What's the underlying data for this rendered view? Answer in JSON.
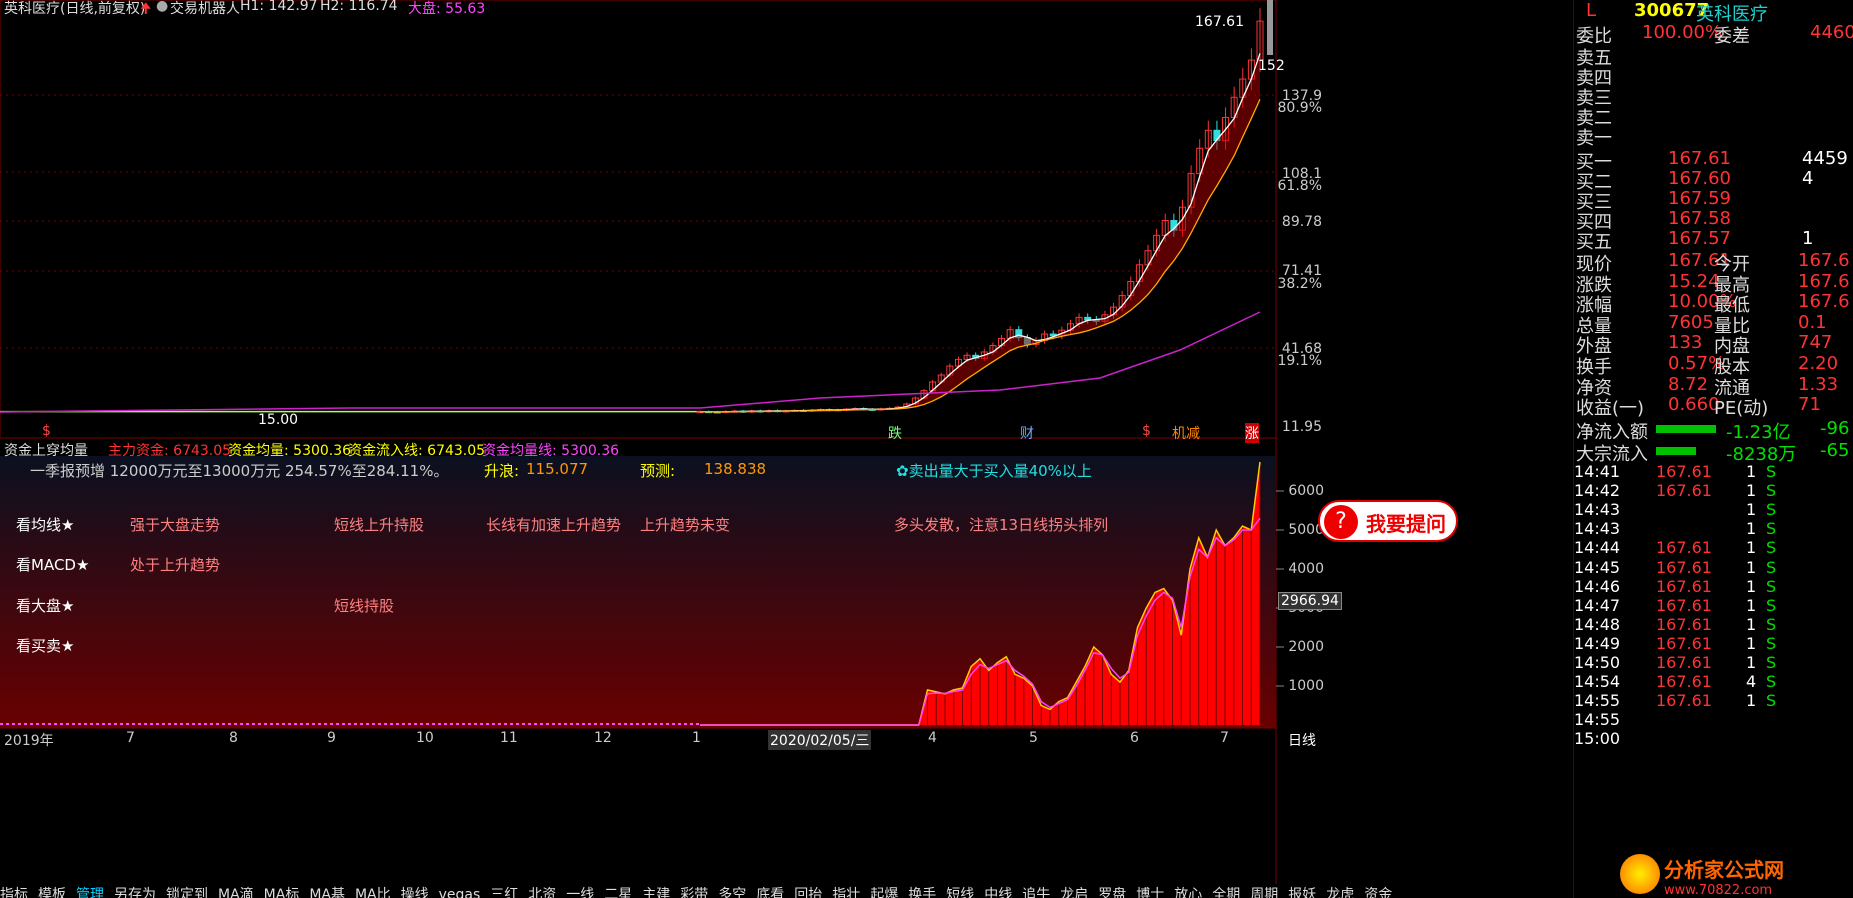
{
  "header": {
    "name": "英科医疗(日线,前复权)",
    "robot": "交易机器人",
    "h1": "H1: 142.97",
    "h2": "H2: 116.74",
    "market": "大盘: 55.63"
  },
  "price_axis": [
    "137.9",
    "80.9%",
    "108.1",
    "61.8%",
    "89.78",
    "71.41",
    "38.2%",
    "41.68",
    "19.1%",
    "11.95"
  ],
  "max_label": "167.61",
  "max_label2": "152",
  "min_label": "15.00",
  "signals": [
    "跌",
    "财",
    "$",
    "机减",
    "涨",
    "$"
  ],
  "indicator_header": {
    "title": "资金上穿均量",
    "main": "主力资金: 6743.05",
    "avg": "资金均量: 5300.36",
    "inflow": "资金流入线: 6743.05",
    "avgline": "资金均量线: 5300.36"
  },
  "notes": {
    "forecast": "一季报预增 12000万元至13000万元 254.57%至284.11%。",
    "rise_label": "升浪:",
    "rise_val": "115.077",
    "pred_label": "预测:",
    "pred_val": "138.838",
    "warn": "✿卖出量大于买入量40%以上"
  },
  "analysis": [
    {
      "label": "看均线★",
      "a": "强于大盘走势",
      "b": "短线上升持股",
      "c": "长线有加速上升趋势",
      "d": "上升趋势未变",
      "e": "多头发散，注意13日线拐头排列"
    },
    {
      "label": "看MACD★",
      "a": "处于上升趋势",
      "b": "",
      "c": "",
      "d": "",
      "e": ""
    },
    {
      "label": "看大盘★",
      "a": "",
      "b": "短线持股",
      "c": "",
      "d": "",
      "e": ""
    },
    {
      "label": "看买卖★",
      "a": "",
      "b": "",
      "c": "",
      "d": "",
      "e": ""
    }
  ],
  "ind_axis": [
    "6000",
    "5000",
    "4000",
    "3000",
    "2000",
    "1000"
  ],
  "ind_current": "2966.94",
  "x_axis": [
    "2019年",
    "7",
    "8",
    "9",
    "10",
    "11",
    "12",
    "1",
    "2020/02/05/三",
    "4",
    "5",
    "6",
    "7"
  ],
  "period": "日线",
  "tabs": [
    "指标",
    "模板",
    "管理",
    "另存为",
    "锁定到",
    "MA滴",
    "MA标",
    "MA基",
    "MA比",
    "操线",
    "vegas",
    "三红",
    "北资",
    "一线",
    "二星",
    "主建",
    "彩带",
    "多空",
    "底看",
    "回抬",
    "指壮",
    "起爆",
    "换手",
    "短线",
    "中线",
    "追牛",
    "龙启",
    "罗盘",
    "博士",
    "放心",
    "全期",
    "周期",
    "报妖",
    "龙虎",
    "资金"
  ],
  "ask_logo": "我要提问",
  "watermark": "分析家公式网",
  "watermark_url": "www.70822.com",
  "quote": {
    "marker": "L",
    "code": "300677",
    "name": "英科医疗",
    "webi_label": "委比",
    "webi": "100.00%",
    "wecha_label": "委差",
    "wecha": "4460",
    "sells": [
      {
        "label": "卖五",
        "price": "",
        "vol": ""
      },
      {
        "label": "卖四",
        "price": "",
        "vol": ""
      },
      {
        "label": "卖三",
        "price": "",
        "vol": ""
      },
      {
        "label": "卖二",
        "price": "",
        "vol": ""
      },
      {
        "label": "卖一",
        "price": "",
        "vol": ""
      }
    ],
    "buys": [
      {
        "label": "买一",
        "price": "167.61",
        "vol": "4459"
      },
      {
        "label": "买二",
        "price": "167.60",
        "vol": "4"
      },
      {
        "label": "买三",
        "price": "167.59",
        "vol": ""
      },
      {
        "label": "买四",
        "price": "167.58",
        "vol": ""
      },
      {
        "label": "买五",
        "price": "167.57",
        "vol": "1"
      }
    ],
    "stats": [
      {
        "l1": "现价",
        "v1": "167.61",
        "l2": "今开",
        "v2": "167.6"
      },
      {
        "l1": "涨跌",
        "v1": "15.24",
        "l2": "最高",
        "v2": "167.6"
      },
      {
        "l1": "涨幅",
        "v1": "10.00%",
        "l2": "最低",
        "v2": "167.6"
      },
      {
        "l1": "总量",
        "v1": "7605",
        "l2": "量比",
        "v2": "0.1"
      },
      {
        "l1": "外盘",
        "v1": "133",
        "l2": "内盘",
        "v2": "747"
      },
      {
        "l1": "换手",
        "v1": "0.57%",
        "l2": "股本",
        "v2": "2.20"
      },
      {
        "l1": "净资",
        "v1": "8.72",
        "l2": "流通",
        "v2": "1.33"
      },
      {
        "l1": "收益(一)",
        "v1": "0.660",
        "l2": "PE(动)",
        "v2": "71"
      }
    ],
    "flow1_label": "净流入额",
    "flow1_a": "-1.23亿",
    "flow1_b": "-96",
    "flow2_label": "大宗流入",
    "flow2_a": "-8238万",
    "flow2_b": "-65",
    "ticks": [
      {
        "t": "14:41",
        "p": "167.61",
        "v": "1",
        "s": "S"
      },
      {
        "t": "14:42",
        "p": "167.61",
        "v": "1",
        "s": "S"
      },
      {
        "t": "14:43",
        "p": "",
        "v": "1",
        "s": "S"
      },
      {
        "t": "14:43",
        "p": "",
        "v": "1",
        "s": "S"
      },
      {
        "t": "14:44",
        "p": "167.61",
        "v": "1",
        "s": "S"
      },
      {
        "t": "14:45",
        "p": "167.61",
        "v": "1",
        "s": "S"
      },
      {
        "t": "14:46",
        "p": "167.61",
        "v": "1",
        "s": "S"
      },
      {
        "t": "14:47",
        "p": "167.61",
        "v": "1",
        "s": "S"
      },
      {
        "t": "14:48",
        "p": "167.61",
        "v": "1",
        "s": "S"
      },
      {
        "t": "14:49",
        "p": "167.61",
        "v": "1",
        "s": "S"
      },
      {
        "t": "14:50",
        "p": "167.61",
        "v": "1",
        "s": "S"
      },
      {
        "t": "14:54",
        "p": "167.61",
        "v": "4",
        "s": "S"
      },
      {
        "t": "14:55",
        "p": "167.61",
        "v": "1",
        "s": "S"
      },
      {
        "t": "14:55",
        "p": "",
        "v": "",
        "s": ""
      },
      {
        "t": "15:00",
        "p": "",
        "v": "",
        "s": ""
      }
    ]
  },
  "chart_data": {
    "type": "line",
    "title": "",
    "price_series_name": "英科医疗",
    "price_close": [
      15.2,
      15.1,
      15.0,
      15.3,
      15.4,
      15.2,
      15.5,
      15.3,
      15.6,
      15.4,
      15.5,
      15.7,
      15.6,
      15.8,
      16.0,
      15.8,
      15.9,
      16.2,
      16.4,
      16.1,
      16.0,
      16.3,
      16.5,
      17.0,
      18.2,
      20.5,
      23.4,
      26.8,
      29.5,
      33.0,
      35.6,
      37.2,
      36.0,
      38.5,
      41.0,
      43.8,
      47.2,
      44.1,
      41.5,
      43.0,
      45.5,
      44.8,
      47.0,
      49.5,
      52.0,
      51.0,
      50.5,
      53.0,
      56.0,
      60.5,
      66.0,
      72.5,
      78.0,
      84.0,
      89.8,
      86.0,
      95.0,
      108.1,
      118.0,
      125.0,
      121.0,
      130.0,
      137.9,
      145.0,
      152.4,
      167.61
    ],
    "ind_series": [
      {
        "name": "主力资金",
        "values": [
          0,
          0,
          0,
          0,
          0,
          0,
          0,
          0,
          0,
          0,
          0,
          0,
          0,
          0,
          0,
          0,
          0,
          0,
          0,
          0,
          0,
          0,
          0,
          0,
          0,
          0,
          900,
          850,
          800,
          900,
          950,
          1500,
          1700,
          1400,
          1600,
          1750,
          1300,
          1200,
          1000,
          500,
          400,
          600,
          700,
          1100,
          1500,
          2000,
          1800,
          1300,
          1100,
          1400,
          2500,
          3000,
          3400,
          3500,
          3200,
          2300,
          4000,
          4800,
          4300,
          5000,
          4600,
          4800,
          5100,
          5000,
          6743.05
        ]
      },
      {
        "name": "资金均量",
        "values": [
          0,
          0,
          0,
          0,
          0,
          0,
          0,
          0,
          0,
          0,
          0,
          0,
          0,
          0,
          0,
          0,
          0,
          0,
          0,
          0,
          0,
          0,
          0,
          0,
          0,
          0,
          800,
          820,
          810,
          860,
          900,
          1300,
          1550,
          1450,
          1550,
          1650,
          1400,
          1250,
          1050,
          600,
          450,
          550,
          650,
          1000,
          1400,
          1850,
          1800,
          1450,
          1200,
          1350,
          2300,
          2800,
          3200,
          3400,
          3250,
          2500,
          3800,
          4500,
          4300,
          4800,
          4600,
          4750,
          5000,
          5000,
          5300.36
        ]
      }
    ],
    "ind_ylim": [
      0,
      7000
    ],
    "price_ylim": [
      11.95,
      170
    ]
  }
}
